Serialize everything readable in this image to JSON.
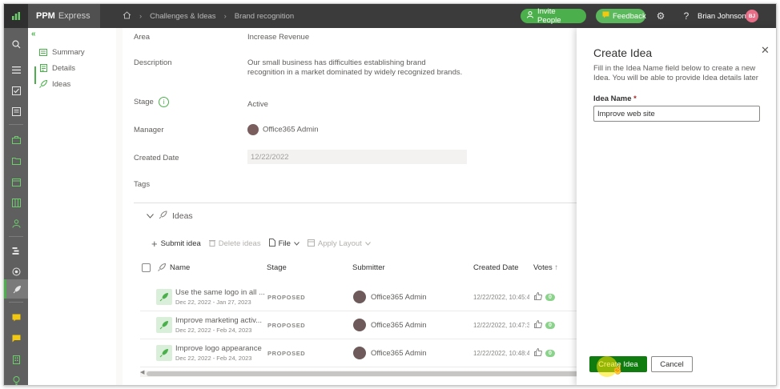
{
  "topbar": {
    "brand_name": "PPM",
    "brand_suffix": "Express",
    "breadcrumbs": [
      "Challenges & Ideas",
      "Brand recognition"
    ],
    "invite_label": "Invite People",
    "feedback_label": "Feedback",
    "user_name": "Brian Johnson",
    "user_initials": "BJ"
  },
  "subnav": {
    "items": [
      {
        "label": "Summary",
        "icon": "summary-icon"
      },
      {
        "label": "Details",
        "icon": "details-icon"
      },
      {
        "label": "Ideas",
        "icon": "rocket-icon"
      }
    ]
  },
  "fields": {
    "area_label": "Area",
    "area_value": "Increase Revenue",
    "description_label": "Description",
    "description_value": "Our small business has difficulties establishing brand recognition in a market dominated by widely recognized brands.",
    "stage_label": "Stage",
    "stage_value": "Active",
    "manager_label": "Manager",
    "manager_value": "Office365 Admin",
    "created_date_label": "Created Date",
    "created_date_value": "12/22/2022",
    "tags_label": "Tags"
  },
  "ideas": {
    "section_title": "Ideas",
    "toolbar": {
      "submit": "Submit idea",
      "delete": "Delete ideas",
      "file": "File",
      "apply_layout": "Apply Layout"
    },
    "columns": {
      "name": "Name",
      "stage": "Stage",
      "submitter": "Submitter",
      "created_date": "Created Date",
      "votes": "Votes"
    },
    "rows": [
      {
        "name": "Use the same logo in all ...",
        "dates": "Dec 22, 2022 - Jan 27, 2023",
        "stage": "PROPOSED",
        "submitter": "Office365 Admin",
        "created": "12/22/2022, 10:45:40",
        "votes": "0"
      },
      {
        "name": "Improve marketing activ...",
        "dates": "Dec 22, 2022 - Feb 24, 2023",
        "stage": "PROPOSED",
        "submitter": "Office365 Admin",
        "created": "12/22/2022, 10:47:32",
        "votes": "0"
      },
      {
        "name": "Improve logo appearance",
        "dates": "Dec 22, 2022 - Feb 24, 2023",
        "stage": "PROPOSED",
        "submitter": "Office365 Admin",
        "created": "12/22/2022, 10:48:40",
        "votes": "0"
      }
    ]
  },
  "panel": {
    "title": "Create Idea",
    "description": "Fill in the Idea Name field below to create a new Idea. You will be able to provide Idea details later",
    "field_label": "Idea Name",
    "required_mark": "*",
    "field_value": "Improve web site",
    "create_label": "Create Idea",
    "cancel_label": "Cancel"
  },
  "colors": {
    "accent": "#4bb04b",
    "primary_button": "#107c10",
    "topbar": "#3b3b3b",
    "rail": "#5f5f5f"
  }
}
